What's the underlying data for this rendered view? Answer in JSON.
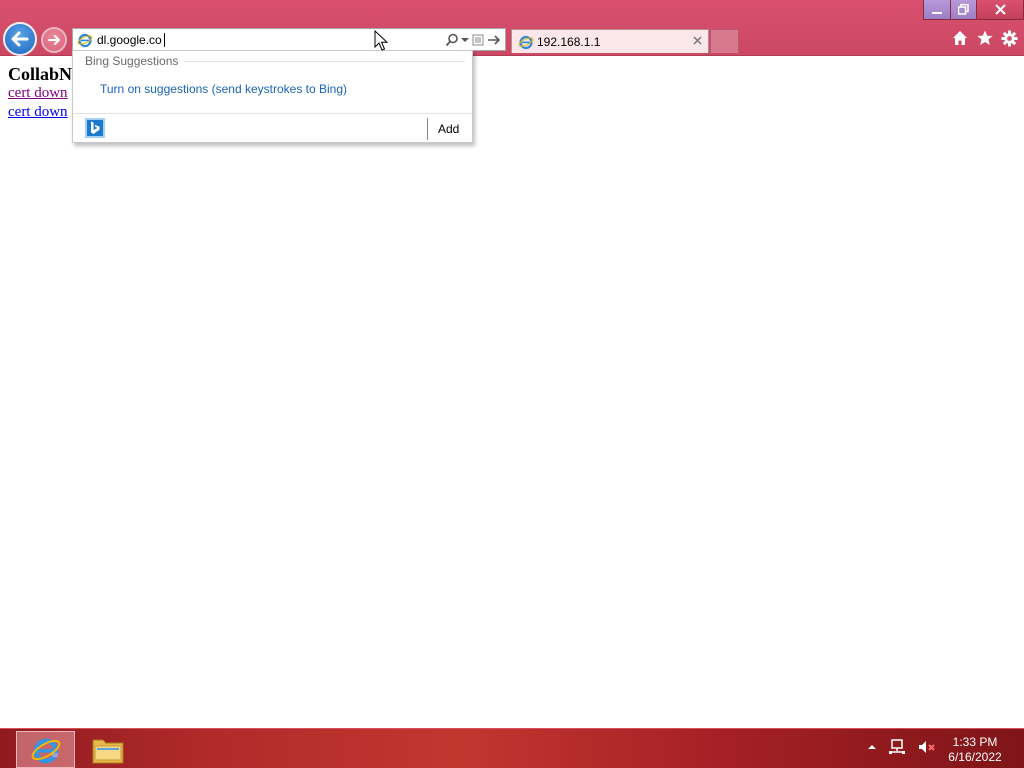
{
  "browser": {
    "address_value": "dl.google.co",
    "tab": {
      "title": "192.168.1.1"
    }
  },
  "window_controls": {
    "minimize_icon": "minimize-icon",
    "maximize_icon": "restore-icon",
    "close_icon": "close-icon"
  },
  "page": {
    "heading": "CollabN",
    "links": [
      "cert down",
      "cert down"
    ]
  },
  "suggestions": {
    "header": "Bing Suggestions",
    "turn_on_link": "Turn on suggestions (send keystrokes to Bing)",
    "add_label": "Add"
  },
  "taskbar": {
    "time": "1:33 PM",
    "date": "6/16/2022"
  },
  "colors": {
    "chrome": "#d9506f",
    "link_blue": "#1a63b8",
    "taskbar": "#b12a2a"
  }
}
